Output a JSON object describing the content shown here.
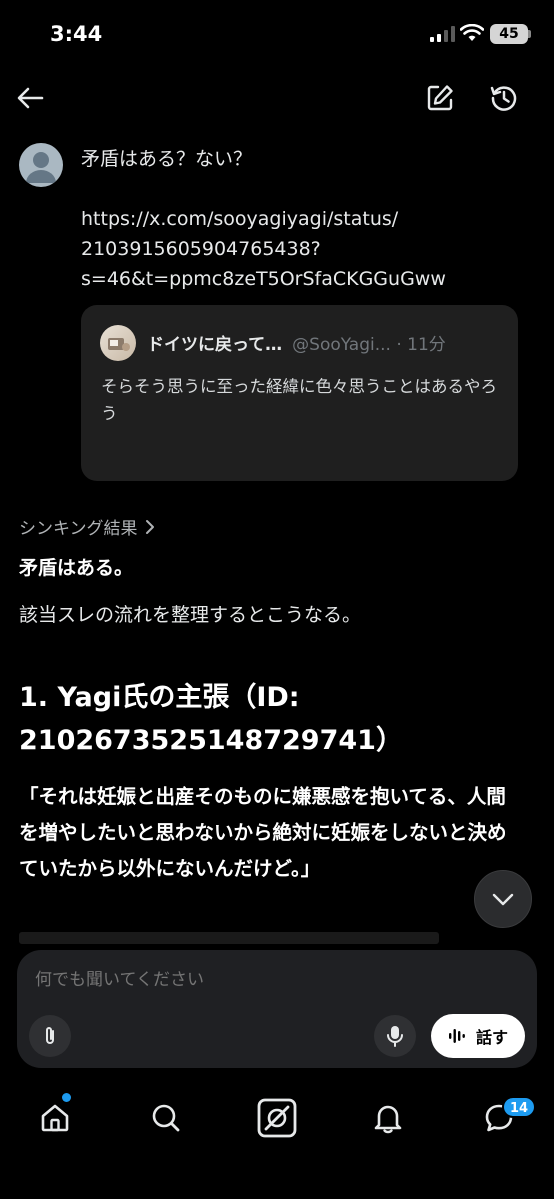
{
  "status_bar": {
    "time": "3:44",
    "battery": "45"
  },
  "user_message": {
    "line1": "矛盾はある？ない？",
    "url_line1": "https://x.com/sooyagiyagi/status/",
    "url_line2": "2103915605904765438?",
    "url_line3": "s=46&t=ppmc8zeT5OrSfaCKGGuGww"
  },
  "quoted_post": {
    "name": "ドイツに戻って…",
    "handle_time": "@SooYagi... · 11分",
    "text": "そらそう思うに至った経緯に色々思うことはあるやろう"
  },
  "answer": {
    "thinking_label": "シンキング結果",
    "strong": "矛盾はある。",
    "paragraph": "該当スレの流れを整理するとこうなる。",
    "heading_line1": "1. Yagi氏の主張（ID:",
    "heading_line2": "2102673525148729741）",
    "quote": "「それは妊娠と出産そのものに嫌悪感を抱いてる、人間を増やしたいと思わないから絶対に妊娠をしないと決めていたから以外にないんだけど。」"
  },
  "composer": {
    "placeholder": "何でも聞いてください",
    "talk_label": "話す"
  },
  "bottom_nav": {
    "messages_badge": "14"
  },
  "colors": {
    "accent": "#1d9bf0",
    "background": "#000000",
    "card": "#1f1f1f"
  }
}
